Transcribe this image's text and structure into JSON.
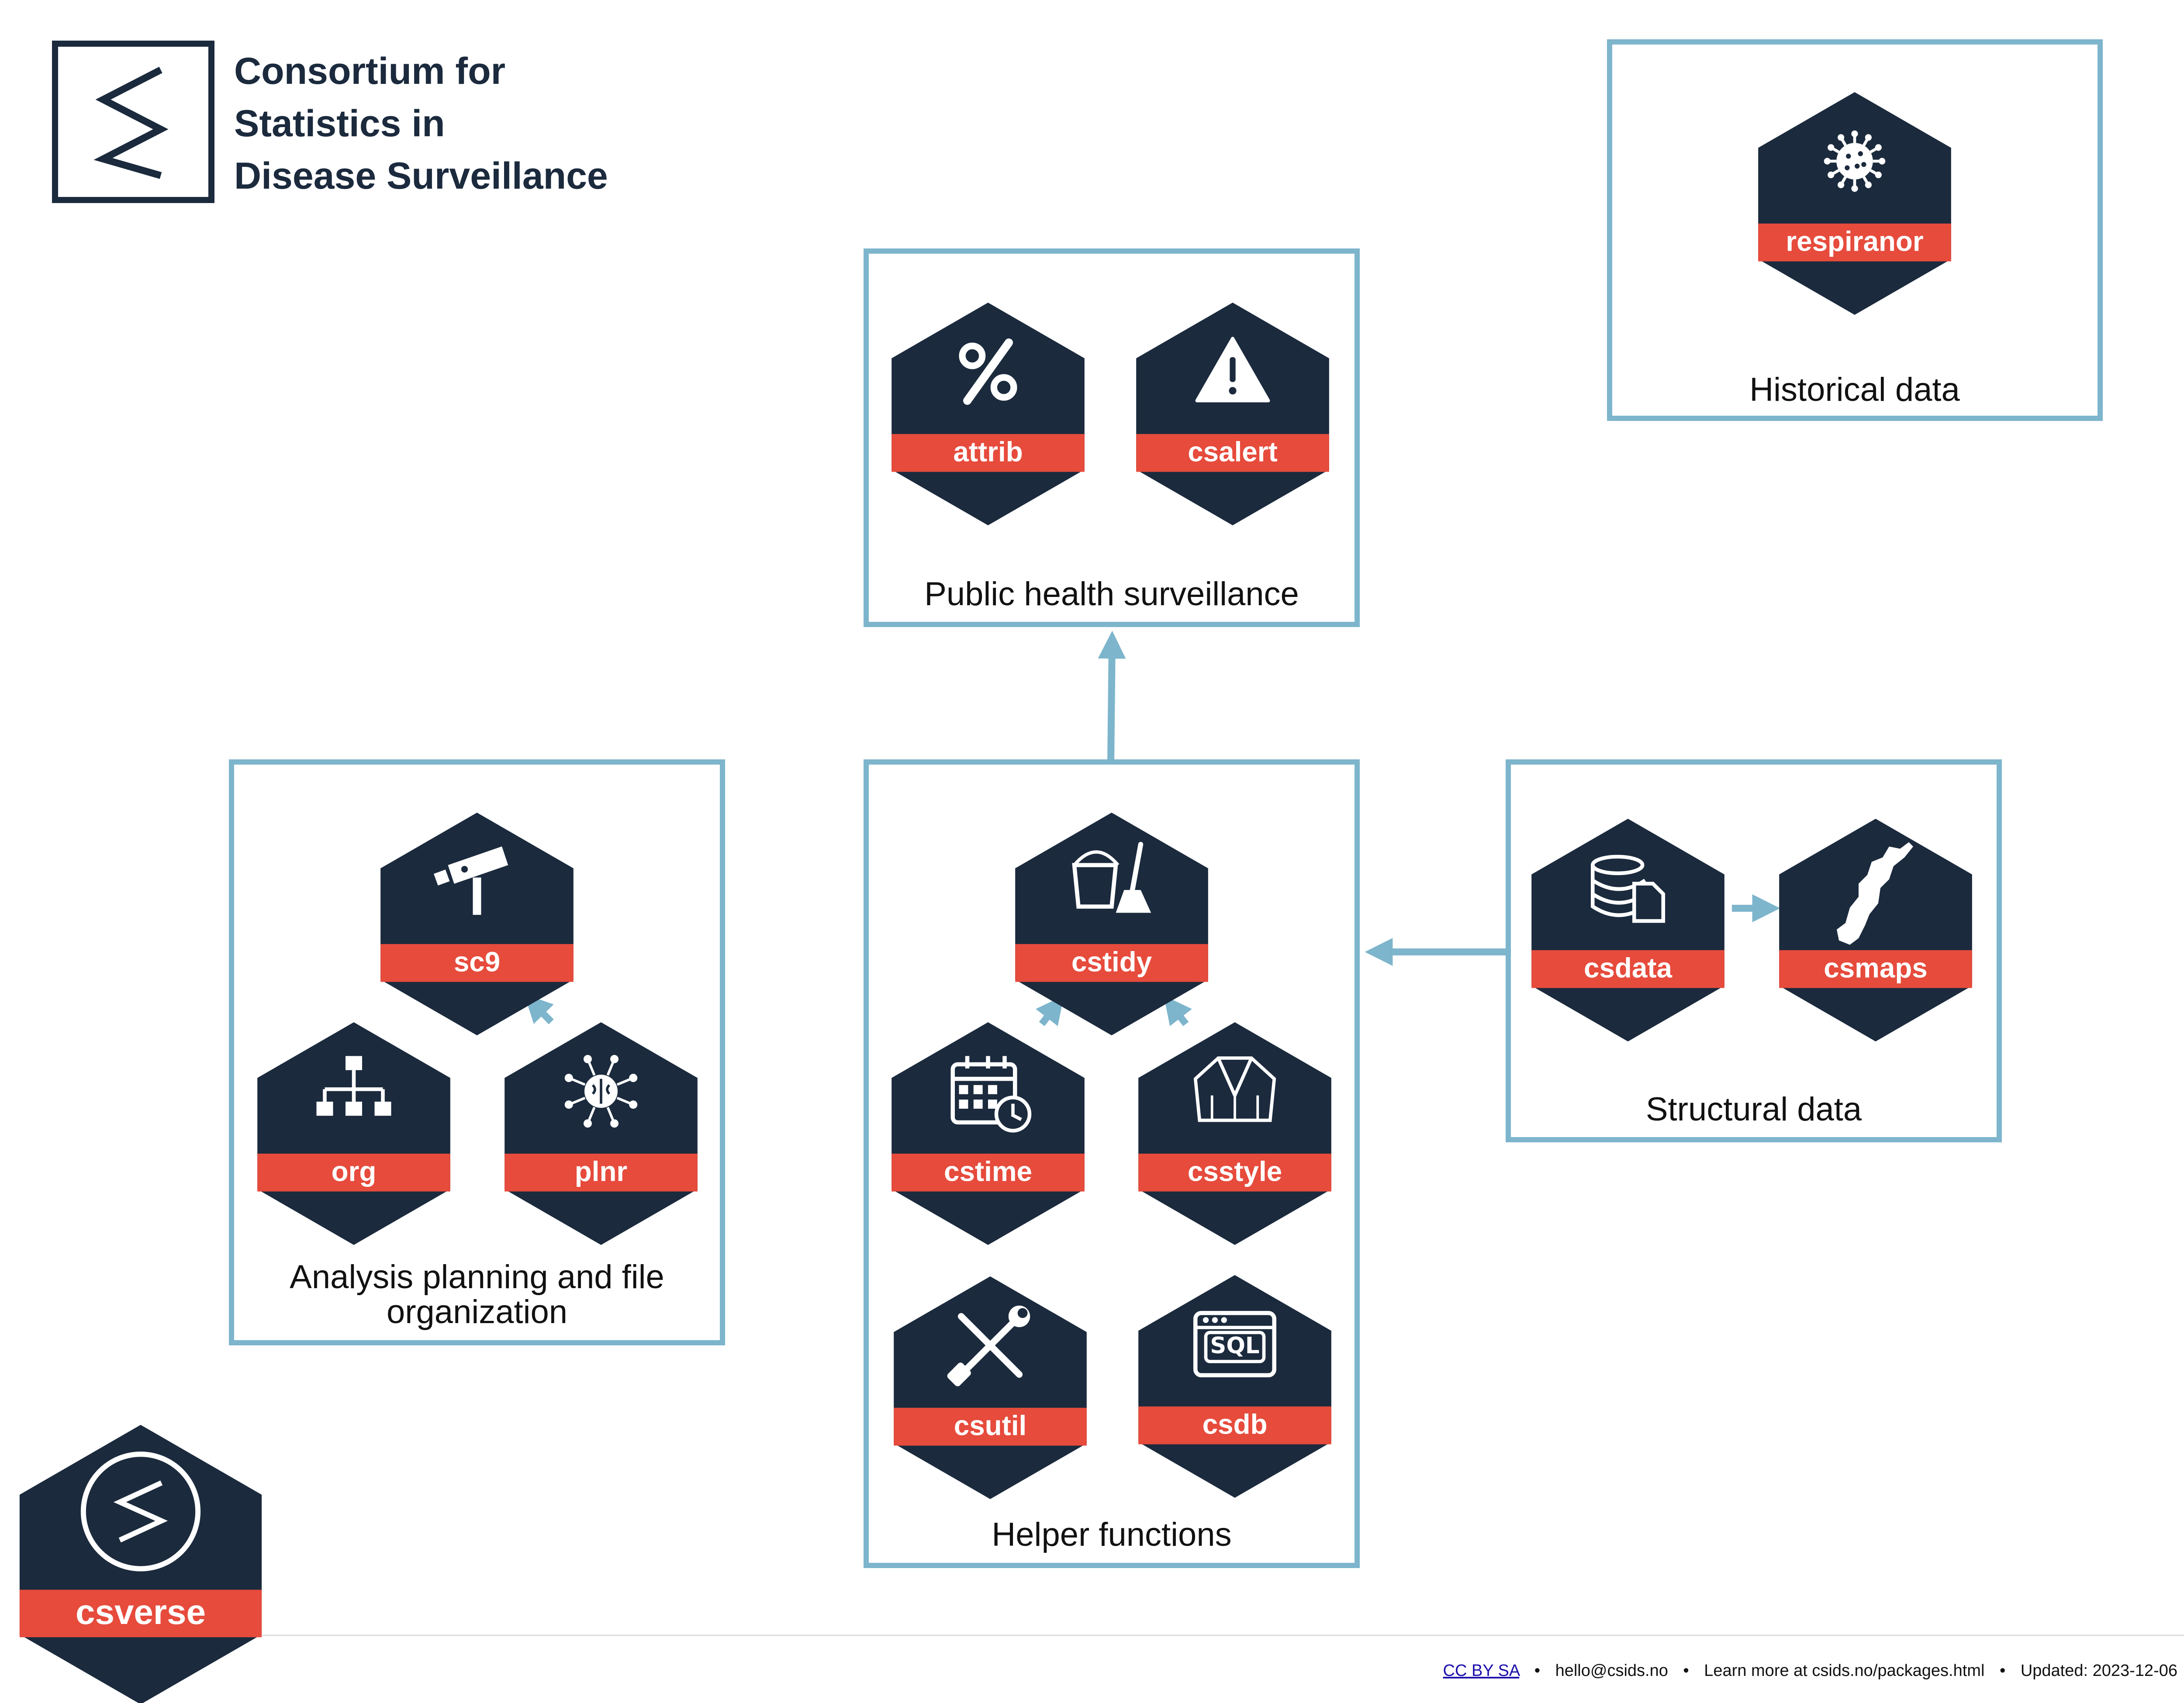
{
  "header": {
    "title_lines": [
      "Consortium for",
      "Statistics in",
      "Disease Surveillance"
    ]
  },
  "groups": {
    "historical": {
      "label": "Historical data"
    },
    "public_health": {
      "label": "Public health surveillance"
    },
    "analysis": {
      "label_lines": [
        "Analysis planning and file",
        "organization"
      ]
    },
    "helper": {
      "label": "Helper functions"
    },
    "structural": {
      "label": "Structural data"
    }
  },
  "packages": {
    "respiranor": {
      "name": "respiranor",
      "icon": "virus-icon"
    },
    "attrib": {
      "name": "attrib",
      "icon": "percent-icon"
    },
    "csalert": {
      "name": "csalert",
      "icon": "warning-icon"
    },
    "sc9": {
      "name": "sc9",
      "icon": "security-camera-icon"
    },
    "org": {
      "name": "org",
      "icon": "sitemap-icon"
    },
    "plnr": {
      "name": "plnr",
      "icon": "brain-network-icon"
    },
    "cstidy": {
      "name": "cstidy",
      "icon": "bucket-broom-icon"
    },
    "cstime": {
      "name": "cstime",
      "icon": "calendar-clock-icon"
    },
    "csstyle": {
      "name": "csstyle",
      "icon": "jacket-icon"
    },
    "csutil": {
      "name": "csutil",
      "icon": "wrench-screwdriver-icon"
    },
    "csdb": {
      "name": "csdb",
      "icon": "sql-window-icon",
      "icon_text": "SQL"
    },
    "csdata": {
      "name": "csdata",
      "icon": "database-file-icon"
    },
    "csmaps": {
      "name": "csmaps",
      "icon": "norway-map-icon"
    },
    "csverse": {
      "name": "csverse",
      "icon": "csids-logo-icon"
    }
  },
  "footer": {
    "license": "CC BY SA",
    "email": "hello@csids.no",
    "learn_more": "Learn more at csids.no/packages.html",
    "updated": "Updated: 2023-12-06",
    "separator": "•"
  },
  "colors": {
    "navy": "#1b2a3d",
    "red": "#e64b3c",
    "box_border": "#7db5cc",
    "arrow": "#7db5cc",
    "text": "#111111"
  }
}
